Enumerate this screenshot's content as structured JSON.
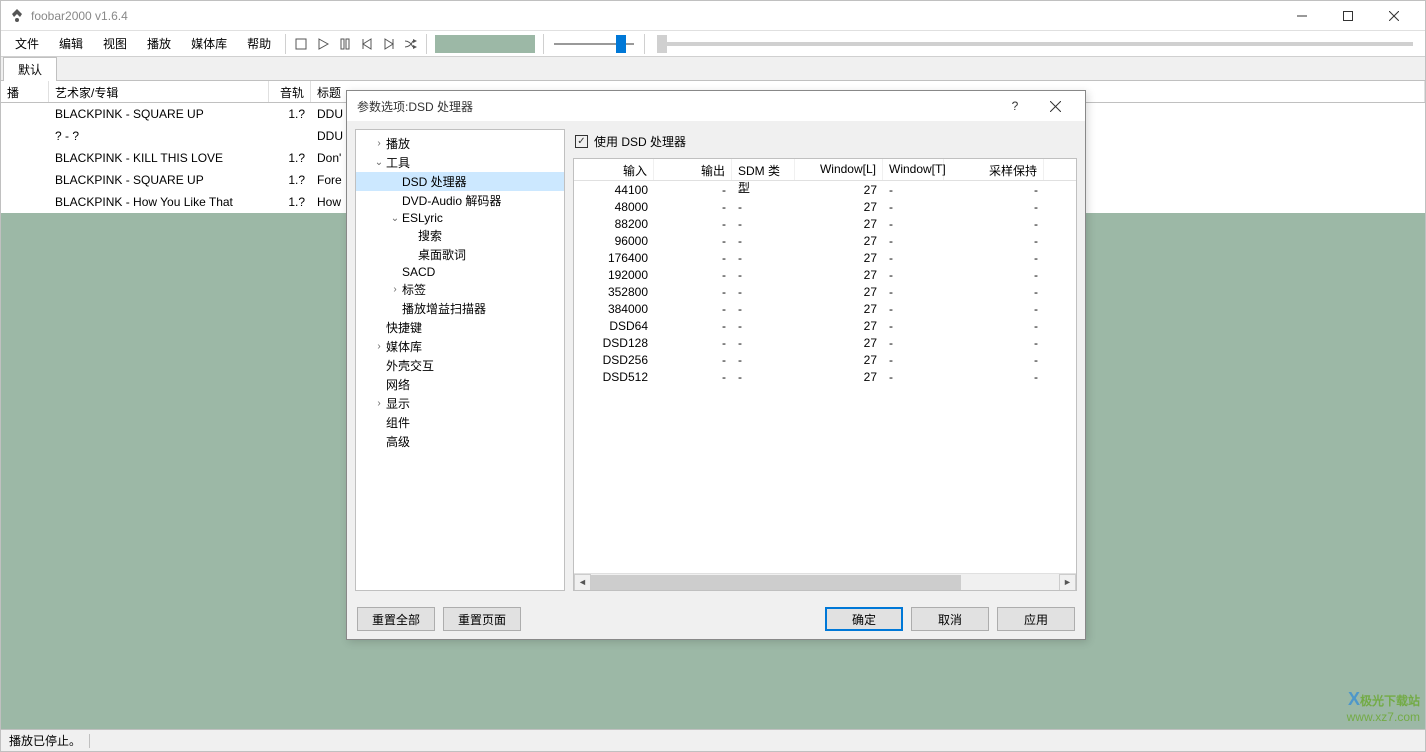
{
  "window": {
    "title": "foobar2000 v1.6.4",
    "menus": [
      "文件",
      "编辑",
      "视图",
      "播放",
      "媒体库",
      "帮助"
    ],
    "tabs": [
      "默认"
    ],
    "columns": {
      "play": "播放…",
      "artist": "艺术家/专辑",
      "track": "音轨号",
      "title": "标题"
    },
    "rows": [
      {
        "artist": "BLACKPINK - SQUARE UP",
        "track": "1.?",
        "title": "DDU"
      },
      {
        "artist": "? - ?",
        "track": "",
        "title": "DDU"
      },
      {
        "artist": "BLACKPINK - KILL THIS LOVE",
        "track": "1.?",
        "title": "Don'"
      },
      {
        "artist": "BLACKPINK - SQUARE UP",
        "track": "1.?",
        "title": "Fore"
      },
      {
        "artist": "BLACKPINK - How You Like That",
        "track": "1.?",
        "title": "How"
      }
    ],
    "status": "播放已停止。"
  },
  "dialog": {
    "title": "参数选项:DSD 处理器",
    "tree": [
      {
        "label": "播放",
        "indent": 1,
        "exp": "›"
      },
      {
        "label": "工具",
        "indent": 1,
        "exp": "⌄"
      },
      {
        "label": "DSD 处理器",
        "indent": 2,
        "exp": "",
        "selected": true
      },
      {
        "label": "DVD-Audio 解码器",
        "indent": 2,
        "exp": ""
      },
      {
        "label": "ESLyric",
        "indent": 2,
        "exp": "⌄"
      },
      {
        "label": "搜索",
        "indent": 3,
        "exp": ""
      },
      {
        "label": "桌面歌词",
        "indent": 3,
        "exp": ""
      },
      {
        "label": "SACD",
        "indent": 2,
        "exp": ""
      },
      {
        "label": "标签",
        "indent": 2,
        "exp": "›"
      },
      {
        "label": "播放增益扫描器",
        "indent": 2,
        "exp": ""
      },
      {
        "label": "快捷键",
        "indent": 1,
        "exp": ""
      },
      {
        "label": "媒体库",
        "indent": 1,
        "exp": "›"
      },
      {
        "label": "外壳交互",
        "indent": 1,
        "exp": ""
      },
      {
        "label": "网络",
        "indent": 1,
        "exp": ""
      },
      {
        "label": "显示",
        "indent": 1,
        "exp": "›"
      },
      {
        "label": "组件",
        "indent": 1,
        "exp": ""
      },
      {
        "label": "高级",
        "indent": 1,
        "exp": ""
      }
    ],
    "checkbox_label": "使用 DSD 处理器",
    "table": {
      "columns": {
        "input": "输入",
        "output": "输出",
        "sdm": "SDM 类型",
        "winl": "Window[L]",
        "wint": "Window[T]",
        "resample": "采样保持"
      },
      "rows": [
        {
          "input": "44100",
          "output": "-",
          "sdm": "-",
          "winl": "27",
          "wint": "-",
          "resample": "-"
        },
        {
          "input": "48000",
          "output": "-",
          "sdm": "-",
          "winl": "27",
          "wint": "-",
          "resample": "-"
        },
        {
          "input": "88200",
          "output": "-",
          "sdm": "-",
          "winl": "27",
          "wint": "-",
          "resample": "-"
        },
        {
          "input": "96000",
          "output": "-",
          "sdm": "-",
          "winl": "27",
          "wint": "-",
          "resample": "-"
        },
        {
          "input": "176400",
          "output": "-",
          "sdm": "-",
          "winl": "27",
          "wint": "-",
          "resample": "-"
        },
        {
          "input": "192000",
          "output": "-",
          "sdm": "-",
          "winl": "27",
          "wint": "-",
          "resample": "-"
        },
        {
          "input": "352800",
          "output": "-",
          "sdm": "-",
          "winl": "27",
          "wint": "-",
          "resample": "-"
        },
        {
          "input": "384000",
          "output": "-",
          "sdm": "-",
          "winl": "27",
          "wint": "-",
          "resample": "-"
        },
        {
          "input": "DSD64",
          "output": "-",
          "sdm": "-",
          "winl": "27",
          "wint": "-",
          "resample": "-"
        },
        {
          "input": "DSD128",
          "output": "-",
          "sdm": "-",
          "winl": "27",
          "wint": "-",
          "resample": "-"
        },
        {
          "input": "DSD256",
          "output": "-",
          "sdm": "-",
          "winl": "27",
          "wint": "-",
          "resample": "-"
        },
        {
          "input": "DSD512",
          "output": "-",
          "sdm": "-",
          "winl": "27",
          "wint": "-",
          "resample": "-"
        }
      ]
    },
    "buttons": {
      "reset_all": "重置全部",
      "reset_page": "重置页面",
      "ok": "确定",
      "cancel": "取消",
      "apply": "应用"
    }
  },
  "watermark": {
    "line1": "极光下载站",
    "line2": "www.xz7.com"
  }
}
